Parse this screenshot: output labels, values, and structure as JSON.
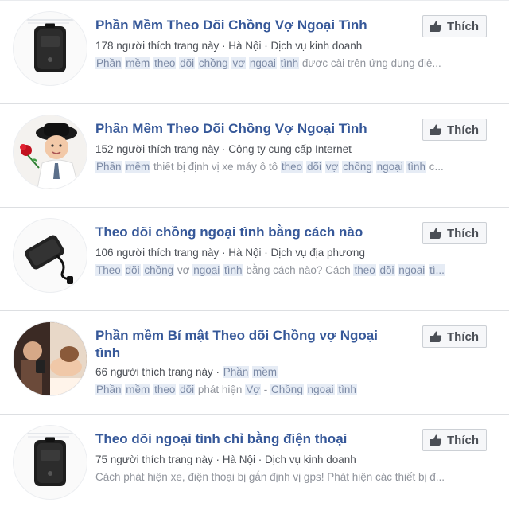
{
  "like_label": "Thích",
  "colors": {
    "title": "#365899",
    "meta": "#4b4f56",
    "snippet": "#90949c",
    "highlight_bg": "#e6ecf5"
  },
  "results": [
    {
      "title": "Phần Mềm Theo Dõi Chồng Vợ Ngoại Tình",
      "meta": "178 người thích trang này · Hà Nội · Dịch vụ kinh doanh",
      "snippet_parts": [
        "Phần",
        " ",
        "mềm",
        " ",
        "theo",
        " ",
        "dõi",
        " ",
        "chồng",
        " ",
        "vợ",
        " ",
        "ngoại",
        " ",
        "tình",
        " được cài trên ứng dụng điệ..."
      ],
      "snippet_highlight": [
        0,
        2,
        4,
        6,
        8,
        10,
        12,
        14
      ],
      "thumb": "gps-tracker-black"
    },
    {
      "title": "Phần Mềm Theo Dõi Chồng Vợ Ngoại Tình",
      "meta": "152 người thích trang này · Công ty cung cấp Internet",
      "snippet_parts": [
        "Phần",
        " ",
        "mềm",
        " thiết bị định vị xe máy ô tô ",
        "theo",
        " ",
        "dõi",
        " ",
        "vợ",
        " ",
        "chồng",
        " ",
        "ngoại",
        " ",
        "tình",
        " c..."
      ],
      "snippet_highlight": [
        0,
        2,
        4,
        6,
        8,
        10,
        12,
        14
      ],
      "thumb": "boy-with-rose"
    },
    {
      "title": "Theo dõi chồng ngoại tình bằng cách nào",
      "meta": "106 người thích trang này · Hà Nội · Dịch vụ địa phương",
      "snippet_parts": [
        "Theo",
        " ",
        "dõi",
        " ",
        "chồng",
        " vợ ",
        "ngoại",
        " ",
        "tình",
        " bằng cách nào? Cách ",
        "theo",
        " ",
        "dõi",
        " ",
        "ngoại",
        " ",
        "tì..."
      ],
      "snippet_highlight": [
        0,
        2,
        4,
        6,
        8,
        10,
        12,
        14,
        16
      ],
      "thumb": "gps-tracker-cable"
    },
    {
      "title": "Phần mềm Bí mật Theo dõi Chồng vợ Ngoại tình",
      "meta_parts": [
        "66 người thích trang này · ",
        "Phần",
        " ",
        "mềm"
      ],
      "meta_highlight": [
        1,
        3
      ],
      "snippet_parts": [
        "Phần",
        " ",
        "mềm",
        " ",
        "theo",
        " ",
        "dõi",
        " phát hiện ",
        "Vợ",
        " - ",
        "Chồng",
        " ",
        "ngoại",
        " ",
        "tình"
      ],
      "snippet_highlight": [
        0,
        2,
        4,
        6,
        8,
        10,
        12,
        14
      ],
      "thumb": "couple-photo",
      "tall": true
    },
    {
      "title": "Theo dõi ngoại tình chỉ bằng điện thoại",
      "meta": "75 người thích trang này · Hà Nội · Dịch vụ kinh doanh",
      "snippet_parts": [
        "Cách phát hiện xe, điện thoại bị gắn định vị gps! Phát hiện các thiết bị đ..."
      ],
      "snippet_highlight": [],
      "thumb": "gps-tracker-black"
    }
  ]
}
